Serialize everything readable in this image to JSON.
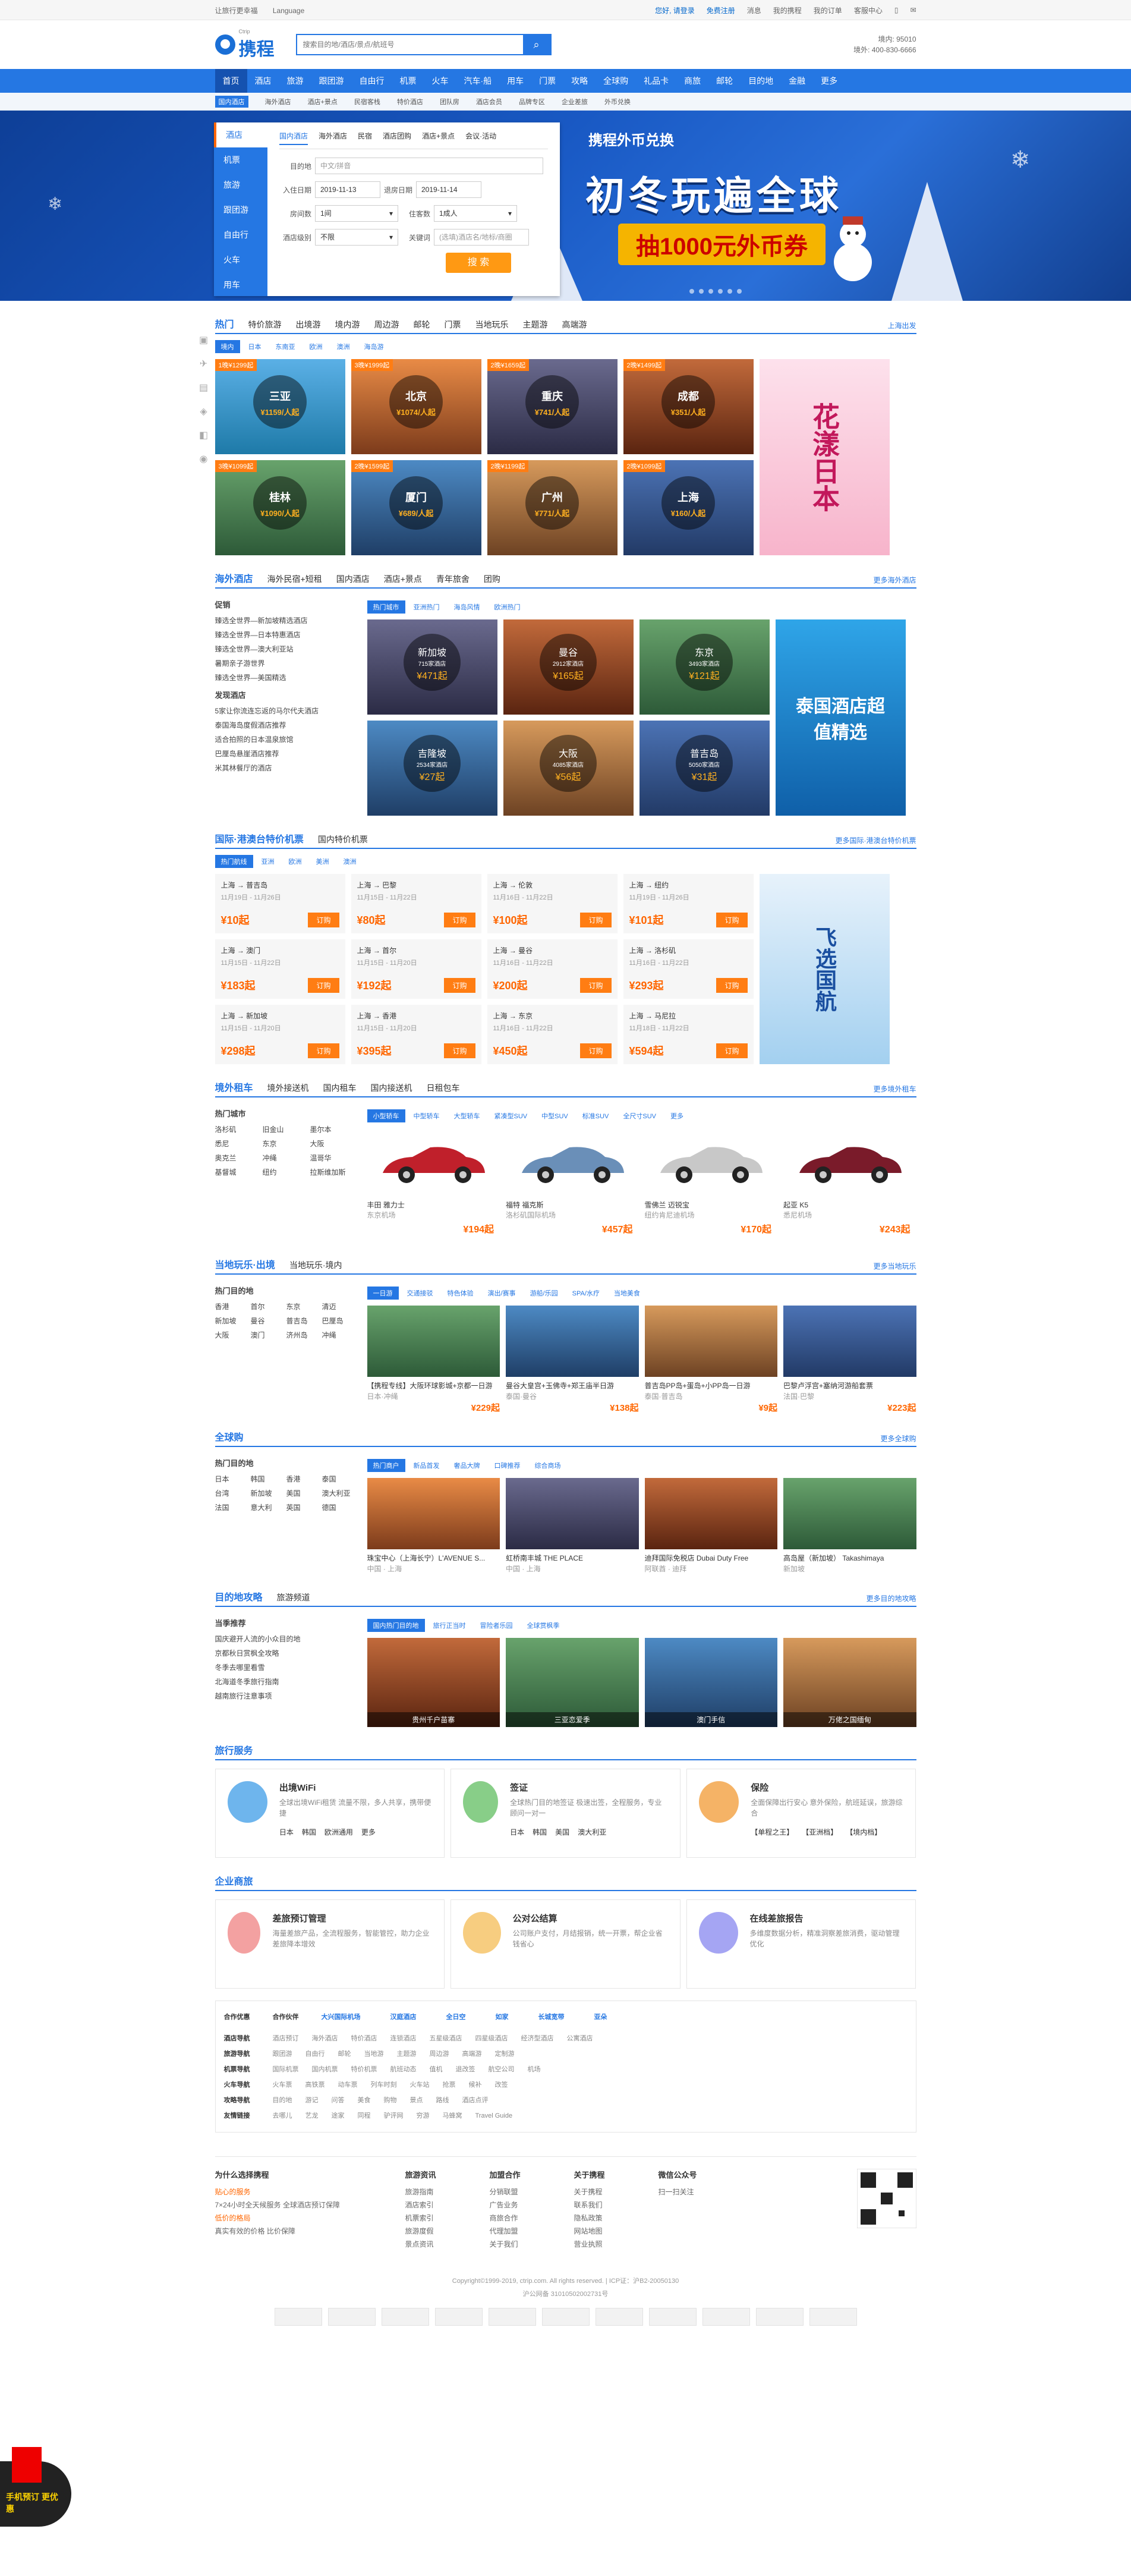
{
  "topbar": {
    "left": [
      "让旅行更幸福",
      "Language"
    ],
    "right": [
      "您好, 请登录",
      "免费注册",
      "消息",
      "我的携程",
      "我的订单",
      "客服中心"
    ]
  },
  "header": {
    "logo": "携程",
    "logo_sub": "Ctrip",
    "search_placeholder": "搜索目的地/酒店/景点/航班号",
    "hotline1": "境内: 95010",
    "hotline2": "境外: 400-830-6666"
  },
  "nav": [
    "首页",
    "酒店",
    "旅游",
    "跟团游",
    "自由行",
    "机票",
    "火车",
    "汽车·船",
    "用车",
    "门票",
    "攻略",
    "全球购",
    "礼品卡",
    "商旅",
    "邮轮",
    "目的地",
    "金融",
    "更多"
  ],
  "subnav": [
    "国内酒店",
    "海外酒店",
    "酒店+景点",
    "民宿客栈",
    "特价酒店",
    "团队房",
    "酒店会员",
    "品牌专区",
    "企业差旅",
    "外币兑换"
  ],
  "booking": {
    "side": [
      "酒店",
      "机票",
      "旅游",
      "跟团游",
      "自由行",
      "火车",
      "用车"
    ],
    "tabs": [
      "国内酒店",
      "海外酒店",
      "民宿",
      "酒店团购",
      "酒店+景点",
      "会议·活动"
    ],
    "dest_label": "目的地",
    "dest_placeholder": "中文/拼音",
    "checkin_label": "入住日期",
    "checkin": "2019-11-13",
    "checkout_label": "退房日期",
    "checkout": "2019-11-14",
    "rooms_label": "房间数",
    "rooms": "1间",
    "guests_label": "住客数",
    "guests": "1成人",
    "star_label": "酒店级别",
    "star": "不限",
    "kw_label": "关键词",
    "kw_placeholder": "(选填)酒店名/地标/商圈",
    "search": "搜 索"
  },
  "banner": {
    "brand": "携程外币兑换",
    "title": "初冬玩遍全球",
    "coupon": "抽1000元外币券"
  },
  "sec1": {
    "tabs": [
      "热门",
      "特价旅游",
      "出境游",
      "境内游",
      "周边游",
      "邮轮",
      "门票",
      "当地玩乐",
      "主题游",
      "高端游"
    ],
    "more": "上海出发",
    "subtabs": [
      "境内",
      "日本",
      "东南亚",
      "欧洲",
      "澳洲",
      "海岛游"
    ],
    "tiles": [
      {
        "badge": "1晚¥1299起",
        "city": "三亚",
        "price": "¥1159/人起"
      },
      {
        "badge": "3晚¥1999起",
        "city": "北京",
        "price": "¥1074/人起"
      },
      {
        "badge": "2晚¥1659起",
        "city": "重庆",
        "price": "¥741/人起"
      },
      {
        "badge": "2晚¥1499起",
        "city": "成都",
        "price": "¥351/人起"
      },
      {
        "badge": "3晚¥1099起",
        "city": "桂林",
        "price": "¥1090/人起"
      },
      {
        "badge": "2晚¥1599起",
        "city": "厦门",
        "price": "¥689/人起"
      },
      {
        "badge": "2晚¥1199起",
        "city": "广州",
        "price": "¥771/人起"
      },
      {
        "badge": "2晚¥1099起",
        "city": "上海",
        "price": "¥160/人起"
      }
    ],
    "promo": "花漾日本"
  },
  "sec2": {
    "tabs": [
      "海外酒店",
      "海外民宿+短租",
      "国内酒店",
      "酒店+景点",
      "青年旅舍",
      "团购"
    ],
    "more": "更多海外酒店",
    "left_h1": "促销",
    "left_items": [
      "臻选全世界—新加坡精选酒店",
      "臻选全世界—日本特惠酒店",
      "臻选全世界—澳大利亚站",
      "暑期亲子游世界",
      "臻选全世界—美国精选"
    ],
    "left_h2": "发现酒店",
    "left_items2": [
      "5家让你流连忘返的马尔代夫酒店",
      "泰国海岛度假酒店推荐",
      "适合拍照的日本温泉旅馆",
      "巴厘岛悬崖酒店推荐",
      "米其林餐厅的酒店"
    ],
    "subtabs": [
      "热门城市",
      "亚洲热门",
      "海岛风情",
      "欧洲热门"
    ],
    "tiles": [
      {
        "city": "新加坡",
        "count": "715家酒店",
        "price": "¥471起"
      },
      {
        "city": "曼谷",
        "count": "2912家酒店",
        "price": "¥165起"
      },
      {
        "city": "东京",
        "count": "3493家酒店",
        "price": "¥121起"
      },
      {
        "city": "吉隆坡",
        "count": "2534家酒店",
        "price": "¥27起"
      },
      {
        "city": "大阪",
        "count": "4085家酒店",
        "price": "¥56起"
      },
      {
        "city": "普吉岛",
        "count": "5050家酒店",
        "price": "¥31起"
      }
    ],
    "promo": "泰国酒店超值精选"
  },
  "sec3": {
    "tabs": [
      "国际·港澳台特价机票",
      "国内特价机票"
    ],
    "more": "更多国际·港澳台特价机票",
    "subtabs": [
      "热门航线",
      "亚洲",
      "欧洲",
      "美洲",
      "澳洲"
    ],
    "flights": [
      {
        "route": "上海 → 普吉岛",
        "date": "11月19日 - 11月26日",
        "price": "¥10起"
      },
      {
        "route": "上海 → 巴黎",
        "date": "11月15日 - 11月22日",
        "price": "¥80起"
      },
      {
        "route": "上海 → 伦敦",
        "date": "11月16日 - 11月22日",
        "price": "¥100起"
      },
      {
        "route": "上海 → 纽约",
        "date": "11月19日 - 11月26日",
        "price": "¥101起"
      },
      {
        "route": "上海 → 澳门",
        "date": "11月15日 - 11月22日",
        "price": "¥183起"
      },
      {
        "route": "上海 → 首尔",
        "date": "11月15日 - 11月20日",
        "price": "¥192起"
      },
      {
        "route": "上海 → 曼谷",
        "date": "11月16日 - 11月22日",
        "price": "¥200起"
      },
      {
        "route": "上海 → 洛杉矶",
        "date": "11月16日 - 11月22日",
        "price": "¥293起"
      },
      {
        "route": "上海 → 新加坡",
        "date": "11月15日 - 11月20日",
        "price": "¥298起"
      },
      {
        "route": "上海 → 香港",
        "date": "11月15日 - 11月20日",
        "price": "¥395起"
      },
      {
        "route": "上海 → 东京",
        "date": "11月16日 - 11月22日",
        "price": "¥450起"
      },
      {
        "route": "上海 → 马尼拉",
        "date": "11月18日 - 11月22日",
        "price": "¥594起"
      }
    ],
    "buy": "订购",
    "promo": "飞选国航"
  },
  "sec4": {
    "tabs": [
      "境外租车",
      "境外接送机",
      "国内租车",
      "国内接送机",
      "日租包车"
    ],
    "more": "更多境外租车",
    "left_h": "热门城市",
    "cities": [
      "洛杉矶",
      "旧金山",
      "墨尔本",
      "悉尼",
      "东京",
      "大阪",
      "奥克兰",
      "冲绳",
      "温哥华",
      "基督城",
      "纽约",
      "拉斯维加斯"
    ],
    "subtabs": [
      "小型轿车",
      "中型轿车",
      "大型轿车",
      "紧凑型SUV",
      "中型SUV",
      "标准SUV",
      "全尺寸SUV",
      "更多"
    ],
    "cars": [
      {
        "name": "丰田 雅力士",
        "loc": "东京机场",
        "price": "¥194起",
        "color": "#c0202b"
      },
      {
        "name": "福特 福克斯",
        "loc": "洛杉矶国际机场",
        "price": "¥457起",
        "color": "#6a8fb8"
      },
      {
        "name": "雪佛兰 迈锐宝",
        "loc": "纽约肯尼迪机场",
        "price": "¥170起",
        "color": "#c8c8c8"
      },
      {
        "name": "起亚 K5",
        "loc": "悉尼机场",
        "price": "¥243起",
        "color": "#7a1b2a"
      }
    ]
  },
  "sec5": {
    "tabs": [
      "当地玩乐·出境",
      "当地玩乐·境内"
    ],
    "more": "更多当地玩乐",
    "left_h": "热门目的地",
    "cities": [
      "香港",
      "首尔",
      "东京",
      "清迈",
      "新加坡",
      "曼谷",
      "普吉岛",
      "巴厘岛",
      "大阪",
      "澳门",
      "济州岛",
      "冲绳"
    ],
    "subtabs": [
      "一日游",
      "交通接驳",
      "特色体验",
      "演出/赛事",
      "游船/乐园",
      "SPA/水疗",
      "当地美食"
    ],
    "items": [
      {
        "t": "【携程专线】大阪环球影城+京都一日游",
        "loc": "日本·冲绳",
        "p": "¥229起"
      },
      {
        "t": "曼谷大皇宫+玉佛寺+郑王庙半日游",
        "loc": "泰国·曼谷",
        "p": "¥138起"
      },
      {
        "t": "普吉岛PP岛+蛋岛+小PP岛一日游",
        "loc": "泰国·普吉岛",
        "p": "¥9起"
      },
      {
        "t": "巴黎卢浮宫+塞纳河游船套票",
        "loc": "法国·巴黎",
        "p": "¥223起"
      }
    ]
  },
  "sec6": {
    "tabs": [
      "全球购"
    ],
    "more": "更多全球购",
    "left_h": "热门目的地",
    "cities": [
      "日本",
      "韩国",
      "香港",
      "泰国",
      "台湾",
      "新加坡",
      "美国",
      "澳大利亚",
      "法国",
      "意大利",
      "英国",
      "德国"
    ],
    "subtabs": [
      "热门商户",
      "新品首发",
      "奢品大牌",
      "口碑推荐",
      "综合商场"
    ],
    "items": [
      {
        "t": "珠宝中心（上海长宁）L'AVENUE S...",
        "loc": "中国 · 上海"
      },
      {
        "t": "虹桥南丰城 THE PLACE",
        "loc": "中国 · 上海"
      },
      {
        "t": "迪拜国际免税店 Dubai Duty Free",
        "loc": "阿联酋 · 迪拜"
      },
      {
        "t": "高岛屋（新加坡） Takashimaya",
        "loc": "新加坡"
      }
    ]
  },
  "sec7": {
    "tabs": [
      "目的地攻略",
      "旅游频道"
    ],
    "more": "更多目的地攻略",
    "left_h": "当季推荐",
    "left_items": [
      "国庆避开人流的小众目的地",
      "京都秋日赏枫全攻略",
      "冬季去哪里看雪",
      "北海道冬季旅行指南",
      "越南旅行注意事项"
    ],
    "subtabs": [
      "国内热门目的地",
      "旅行正当时",
      "冒险者乐园",
      "全球赏枫季"
    ],
    "items": [
      {
        "t": "贵州千户苗寨"
      },
      {
        "t": "三亚恋爱季"
      },
      {
        "t": "澳门手信"
      },
      {
        "t": "万佬之国缅甸"
      }
    ]
  },
  "sec8": {
    "title": "旅行服务",
    "services": [
      {
        "name": "出境WiFi",
        "desc": "全球出境WiFi租赁 流量不限，多人共享，携带便捷",
        "opts": [
          "日本",
          "韩国",
          "欧洲通用",
          "更多"
        ],
        "color": "#4aa3e8"
      },
      {
        "name": "签证",
        "desc": "全球热门目的地签证 极速出签，全程服务，专业顾问一对一",
        "opts": [
          "日本",
          "韩国",
          "美国",
          "澳大利亚"
        ],
        "color": "#6ac26a"
      },
      {
        "name": "保险",
        "desc": "全面保障出行安心 意外保险，航班延误，旅游综合",
        "opts": [
          "【单程之王】",
          "【亚洲档】",
          "【境内档】"
        ],
        "color": "#f2a040"
      }
    ]
  },
  "sec9": {
    "title": "企业商旅",
    "services": [
      {
        "name": "差旅预订管理",
        "desc": "海量差旅产品，全流程服务，智能管控，助力企业差旅降本增效",
        "color": "#f08a8a"
      },
      {
        "name": "公对公结算",
        "desc": "公司账户支付，月结报销，统一开票，帮企业省钱省心",
        "color": "#f5c060"
      },
      {
        "name": "在线差旅报告",
        "desc": "多维度数据分析，精准洞察差旅消费，驱动管理优化",
        "color": "#8f8ff0"
      }
    ]
  },
  "partners": {
    "h1": "合作优惠",
    "h2": "合作伙伴",
    "items": [
      "大兴国际机场",
      "汉庭酒店",
      "全日空",
      "如家",
      "长城宽带",
      "亚朵"
    ]
  },
  "links": [
    {
      "h": "酒店导航",
      "items": [
        "酒店预订",
        "海外酒店",
        "特价酒店",
        "连锁酒店",
        "五星级酒店",
        "四星级酒店",
        "经济型酒店",
        "公寓酒店"
      ]
    },
    {
      "h": "旅游导航",
      "items": [
        "跟团游",
        "自由行",
        "邮轮",
        "当地游",
        "主题游",
        "周边游",
        "高端游",
        "定制游"
      ]
    },
    {
      "h": "机票导航",
      "items": [
        "国际机票",
        "国内机票",
        "特价机票",
        "航班动态",
        "值机",
        "退改签",
        "航空公司",
        "机场"
      ]
    },
    {
      "h": "火车导航",
      "items": [
        "火车票",
        "高铁票",
        "动车票",
        "列车时刻",
        "火车站",
        "抢票",
        "候补",
        "改签"
      ]
    },
    {
      "h": "攻略导航",
      "items": [
        "目的地",
        "游记",
        "问答",
        "美食",
        "购物",
        "景点",
        "路线",
        "酒店点评"
      ]
    },
    {
      "h": "友情链接",
      "items": [
        "去哪儿",
        "艺龙",
        "途家",
        "同程",
        "驴评网",
        "穷游",
        "马蜂窝",
        "Travel Guide"
      ]
    }
  ],
  "footer": {
    "why": "为什么选择携程",
    "why1": "贴心的服务",
    "why1d": "7×24小时全天候服务 全球酒店预订保障",
    "why2": "低价的格局",
    "why2d": "真实有效的价格 比价保障",
    "cols": [
      {
        "h": "旅游资讯",
        "items": [
          "旅游指南",
          "酒店索引",
          "机票索引",
          "旅游度假",
          "景点资讯"
        ]
      },
      {
        "h": "加盟合作",
        "items": [
          "分销联盟",
          "广告业务",
          "商旅合作",
          "代理加盟",
          "关于我们"
        ]
      },
      {
        "h": "关于携程",
        "items": [
          "关于携程",
          "联系我们",
          "隐私政策",
          "网站地图",
          "营业执照"
        ]
      },
      {
        "h": "微信公众号",
        "items": [
          "扫一扫关注"
        ]
      }
    ],
    "copyright": "Copyright©1999-2019, ctrip.com. All rights reserved. | ICP证：沪B2-20050130",
    "addr": "沪公网备 31010502002731号",
    "float": "手机预订 更优惠"
  }
}
